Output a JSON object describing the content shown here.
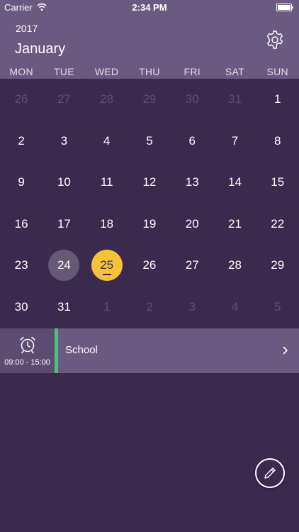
{
  "status_bar": {
    "carrier": "Carrier",
    "time": "2:34 PM"
  },
  "header": {
    "year": "2017",
    "month": "January"
  },
  "weekdays": [
    "MON",
    "TUE",
    "WED",
    "THU",
    "FRI",
    "SAT",
    "SUN"
  ],
  "calendar": {
    "weeks": [
      [
        {
          "d": "26",
          "other": true
        },
        {
          "d": "27",
          "other": true
        },
        {
          "d": "28",
          "other": true
        },
        {
          "d": "29",
          "other": true
        },
        {
          "d": "30",
          "other": true
        },
        {
          "d": "31",
          "other": true
        },
        {
          "d": "1"
        }
      ],
      [
        {
          "d": "2"
        },
        {
          "d": "3"
        },
        {
          "d": "4"
        },
        {
          "d": "5"
        },
        {
          "d": "6"
        },
        {
          "d": "7"
        },
        {
          "d": "8"
        }
      ],
      [
        {
          "d": "9"
        },
        {
          "d": "10"
        },
        {
          "d": "11"
        },
        {
          "d": "12"
        },
        {
          "d": "13"
        },
        {
          "d": "14"
        },
        {
          "d": "15"
        }
      ],
      [
        {
          "d": "16"
        },
        {
          "d": "17"
        },
        {
          "d": "18"
        },
        {
          "d": "19"
        },
        {
          "d": "20"
        },
        {
          "d": "21"
        },
        {
          "d": "22"
        }
      ],
      [
        {
          "d": "23"
        },
        {
          "d": "24",
          "selected": true
        },
        {
          "d": "25",
          "today": true,
          "event": true
        },
        {
          "d": "26"
        },
        {
          "d": "27"
        },
        {
          "d": "28"
        },
        {
          "d": "29"
        }
      ],
      [
        {
          "d": "30"
        },
        {
          "d": "31"
        },
        {
          "d": "1",
          "other": true
        },
        {
          "d": "2",
          "other": true
        },
        {
          "d": "3",
          "other": true
        },
        {
          "d": "4",
          "other": true
        },
        {
          "d": "5",
          "other": true
        }
      ]
    ]
  },
  "event": {
    "title": "School",
    "time": "09:00 - 15:00"
  },
  "colors": {
    "background": "#3b2a4e",
    "header": "#6b5a80",
    "today": "#f5c335",
    "selected": "#655a75",
    "event_accent": "#4fc07c"
  },
  "icons": {
    "settings": "gear-icon",
    "alarm": "alarm-clock-icon",
    "chevron": "chevron-right-icon",
    "edit": "pencil-icon"
  }
}
